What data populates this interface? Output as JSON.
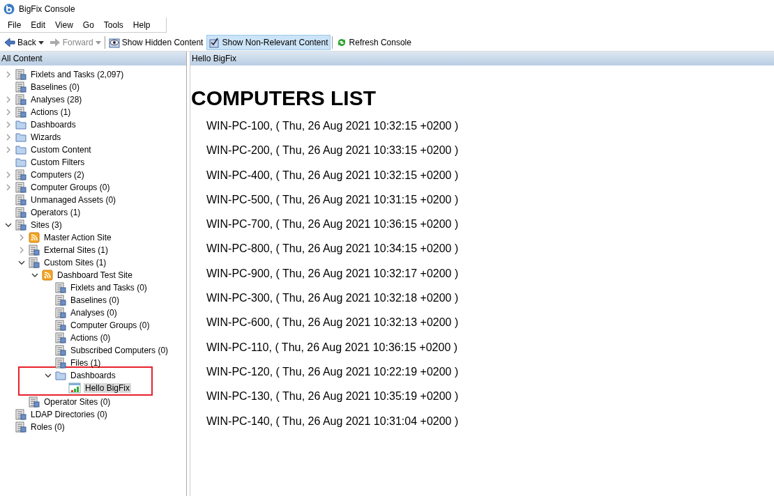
{
  "window": {
    "title": "BigFix Console"
  },
  "menu": [
    "File",
    "Edit",
    "View",
    "Go",
    "Tools",
    "Help"
  ],
  "toolbar": [
    {
      "label": "Back",
      "kind": "back",
      "disabled": false,
      "dropdown": true,
      "on": false
    },
    {
      "label": "Forward",
      "kind": "forward",
      "disabled": true,
      "dropdown": true,
      "on": false
    },
    {
      "label": "Show Hidden Content",
      "kind": "hidden",
      "disabled": false,
      "dropdown": false,
      "on": false
    },
    {
      "label": "Show Non-Relevant Content",
      "kind": "nonrelevant",
      "disabled": false,
      "dropdown": false,
      "on": true
    },
    {
      "label": "Refresh Console",
      "kind": "refresh",
      "disabled": false,
      "dropdown": false,
      "on": false
    }
  ],
  "sidebar": {
    "title": "All Content",
    "items": [
      {
        "label": "Fixlets and Tasks (2,097)",
        "kind": "list",
        "expanded": false,
        "selected": false
      },
      {
        "label": "Baselines (0)",
        "kind": "list",
        "selected": false
      },
      {
        "label": "Analyses (28)",
        "kind": "list",
        "expanded": false,
        "selected": false
      },
      {
        "label": "Actions (1)",
        "kind": "list",
        "expanded": false,
        "selected": false
      },
      {
        "label": "Dashboards",
        "kind": "folder",
        "expanded": false,
        "selected": false
      },
      {
        "label": "Wizards",
        "kind": "folder",
        "expanded": false,
        "selected": false
      },
      {
        "label": "Custom Content",
        "kind": "folder",
        "expanded": false,
        "selected": false
      },
      {
        "label": "Custom Filters",
        "kind": "folder",
        "selected": false
      },
      {
        "label": "Computers (2)",
        "kind": "list",
        "expanded": false,
        "selected": false
      },
      {
        "label": "Computer Groups (0)",
        "kind": "list",
        "expanded": false,
        "selected": false
      },
      {
        "label": "Unmanaged Assets (0)",
        "kind": "list",
        "selected": false
      },
      {
        "label": "Operators (1)",
        "kind": "list",
        "selected": false
      },
      {
        "label": "Sites (3)",
        "kind": "list",
        "expanded": true,
        "selected": false,
        "children": [
          {
            "label": "Master Action Site",
            "kind": "feed",
            "expanded": false,
            "selected": false
          },
          {
            "label": "External Sites (1)",
            "kind": "list",
            "expanded": false,
            "selected": false
          },
          {
            "label": "Custom Sites (1)",
            "kind": "list",
            "expanded": true,
            "selected": false,
            "children": [
              {
                "label": "Dashboard Test Site",
                "kind": "feed",
                "expanded": true,
                "selected": false,
                "children": [
                  {
                    "label": "Fixlets and Tasks (0)",
                    "kind": "list",
                    "selected": false
                  },
                  {
                    "label": "Baselines (0)",
                    "kind": "list",
                    "selected": false
                  },
                  {
                    "label": "Analyses (0)",
                    "kind": "list",
                    "selected": false
                  },
                  {
                    "label": "Computer Groups (0)",
                    "kind": "list",
                    "selected": false
                  },
                  {
                    "label": "Actions (0)",
                    "kind": "list",
                    "selected": false
                  },
                  {
                    "label": "Subscribed Computers (0)",
                    "kind": "list",
                    "selected": false
                  },
                  {
                    "label": "Files (1)",
                    "kind": "list",
                    "selected": false
                  },
                  {
                    "label": "Dashboards",
                    "kind": "folder",
                    "expanded": true,
                    "selected": false,
                    "highlighted": true,
                    "children": [
                      {
                        "label": "Hello BigFix",
                        "kind": "dashboard",
                        "selected": true
                      }
                    ]
                  }
                ]
              }
            ]
          },
          {
            "label": "Operator Sites (0)",
            "kind": "list",
            "selected": false
          }
        ]
      },
      {
        "label": "LDAP Directories (0)",
        "kind": "list",
        "selected": false
      },
      {
        "label": "Roles (0)",
        "kind": "list",
        "selected": false
      }
    ]
  },
  "content": {
    "title": "Hello BigFix",
    "heading": "COMPUTERS LIST",
    "items": [
      "WIN-PC-100, ( Thu, 26 Aug 2021 10:32:15 +0200 )",
      "WIN-PC-200, ( Thu, 26 Aug 2021 10:33:15 +0200 )",
      "WIN-PC-400, ( Thu, 26 Aug 2021 10:32:15 +0200 )",
      "WIN-PC-500, ( Thu, 26 Aug 2021 10:31:15 +0200 )",
      "WIN-PC-700, ( Thu, 26 Aug 2021 10:36:15 +0200 )",
      "WIN-PC-800, ( Thu, 26 Aug 2021 10:34:15 +0200 )",
      "WIN-PC-900, ( Thu, 26 Aug 2021 10:32:17 +0200 )",
      "WIN-PC-300, ( Thu, 26 Aug 2021 10:32:18 +0200 )",
      "WIN-PC-600, ( Thu, 26 Aug 2021 10:32:13 +0200 )",
      "WIN-PC-110, ( Thu, 26 Aug 2021 10:36:15 +0200 )",
      "WIN-PC-120, ( Thu, 26 Aug 2021 10:22:19 +0200 )",
      "WIN-PC-130, ( Thu, 26 Aug 2021 10:35:19 +0200 )",
      "WIN-PC-140, ( Thu, 26 Aug 2021 10:31:04 +0200 )"
    ]
  }
}
